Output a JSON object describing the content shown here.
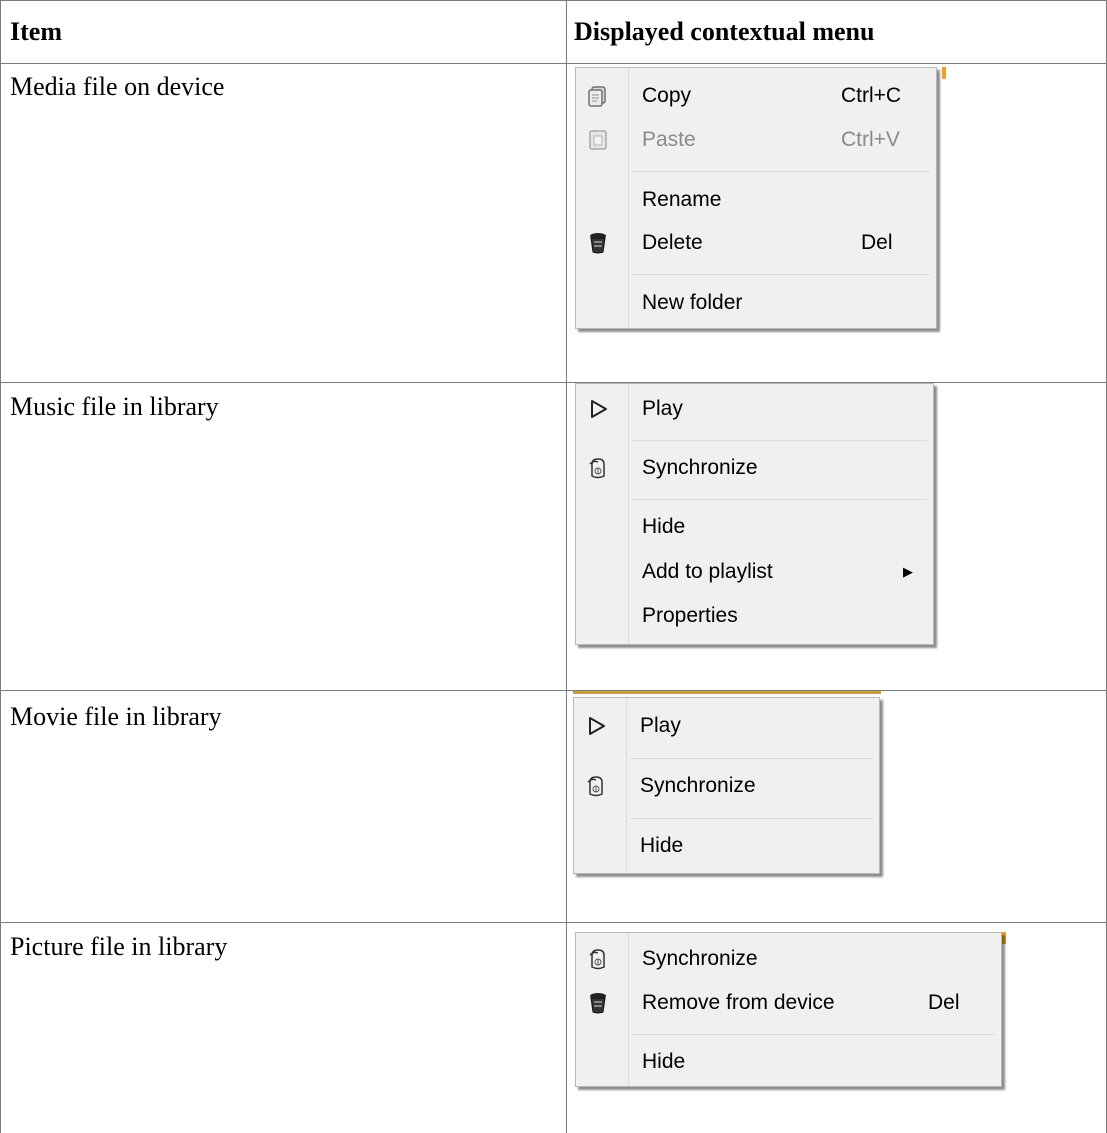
{
  "table": {
    "header": {
      "item": "Item",
      "menu": "Displayed contextual menu"
    },
    "rows": [
      {
        "item": "Media file on device",
        "menu": [
          {
            "icon": "copy-icon",
            "label": "Copy",
            "shortcut": "Ctrl+C",
            "disabled": false
          },
          {
            "icon": "paste-icon",
            "label": "Paste",
            "shortcut": "Ctrl+V",
            "disabled": true
          },
          {
            "icon": null,
            "label": "Rename",
            "shortcut": ""
          },
          {
            "icon": "trash-icon",
            "label": "Delete",
            "shortcut": "Del"
          },
          {
            "icon": null,
            "label": "New folder",
            "shortcut": ""
          }
        ]
      },
      {
        "item": "Music file in library",
        "menu": [
          {
            "icon": "play-icon",
            "label": "Play"
          },
          {
            "icon": "sync-icon",
            "label": "Synchronize"
          },
          {
            "icon": null,
            "label": "Hide"
          },
          {
            "icon": null,
            "label": "Add to playlist",
            "submenu": true
          },
          {
            "icon": null,
            "label": "Properties"
          }
        ]
      },
      {
        "item": "Movie file in library",
        "menu": [
          {
            "icon": "play-icon",
            "label": "Play"
          },
          {
            "icon": "sync-icon",
            "label": "Synchronize"
          },
          {
            "icon": null,
            "label": "Hide"
          }
        ]
      },
      {
        "item": "Picture file in library",
        "menu": [
          {
            "icon": "sync-icon",
            "label": "Synchronize"
          },
          {
            "icon": "trash-icon",
            "label": "Remove from device",
            "shortcut": "Del"
          },
          {
            "icon": null,
            "label": "Hide"
          }
        ]
      }
    ]
  },
  "colors": {
    "menu_bg": "#f0f0f0",
    "border": "#b8b8b8",
    "disabled_text": "#8a8a8a",
    "accent": "#f0a020"
  }
}
